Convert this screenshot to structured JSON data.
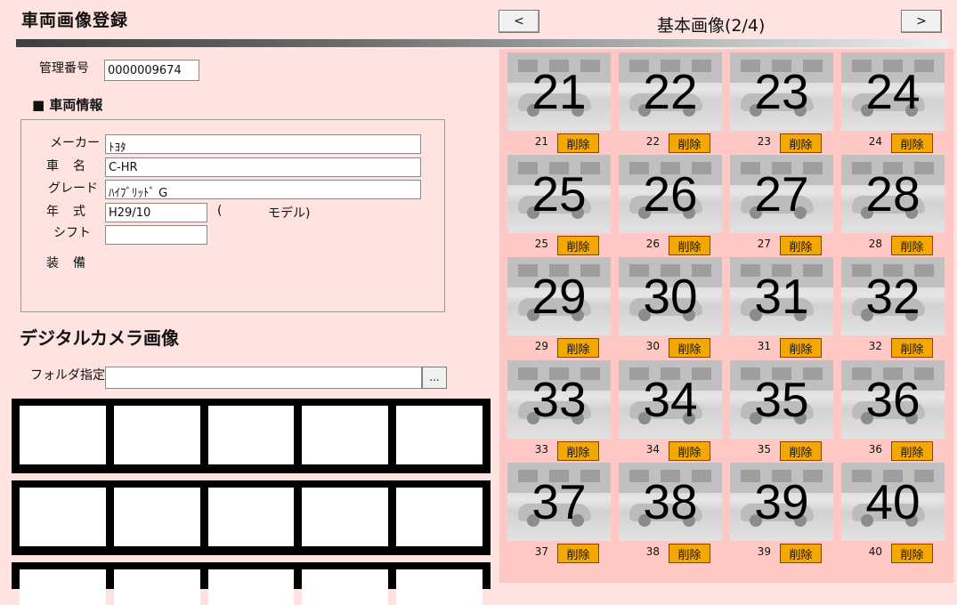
{
  "header": {
    "title": "車両画像登録",
    "prev_label": "<",
    "next_label": ">",
    "page_heading": "基本画像(2/4)"
  },
  "form": {
    "management_no_label": "管理番号",
    "management_no_value": "0000009674",
    "vehicle_info_heading": "■ 車両情報",
    "maker_label": "メーカー",
    "maker_value": "ﾄﾖﾀ",
    "name_label": "車名",
    "name_value": "C-HR",
    "grade_label": "グレード",
    "grade_value": "ﾊｲﾌﾞﾘｯﾄﾞ G",
    "year_label": "年式",
    "year_value": "H29/10",
    "model_paren_open": "(",
    "model_text": "モデル)",
    "shift_label": "シフト",
    "shift_value": "",
    "equipment_label": "装備"
  },
  "camera": {
    "heading": "デジタルカメラ画像",
    "folder_label": "フォルダ指定",
    "folder_value": "",
    "browse_label": "..."
  },
  "images": [
    {
      "no": "21",
      "delete_label": "削除"
    },
    {
      "no": "22",
      "delete_label": "削除"
    },
    {
      "no": "23",
      "delete_label": "削除"
    },
    {
      "no": "24",
      "delete_label": "削除"
    },
    {
      "no": "25",
      "delete_label": "削除"
    },
    {
      "no": "26",
      "delete_label": "削除"
    },
    {
      "no": "27",
      "delete_label": "削除"
    },
    {
      "no": "28",
      "delete_label": "削除"
    },
    {
      "no": "29",
      "delete_label": "削除"
    },
    {
      "no": "30",
      "delete_label": "削除"
    },
    {
      "no": "31",
      "delete_label": "削除"
    },
    {
      "no": "32",
      "delete_label": "削除"
    },
    {
      "no": "33",
      "delete_label": "削除"
    },
    {
      "no": "34",
      "delete_label": "削除"
    },
    {
      "no": "35",
      "delete_label": "削除"
    },
    {
      "no": "36",
      "delete_label": "削除"
    },
    {
      "no": "37",
      "delete_label": "削除"
    },
    {
      "no": "38",
      "delete_label": "削除"
    },
    {
      "no": "39",
      "delete_label": "削除"
    },
    {
      "no": "40",
      "delete_label": "削除"
    }
  ],
  "colors": {
    "background": "#ffe3e1",
    "grid_panel": "#ffc8c4",
    "delete_button": "#f5a800"
  }
}
